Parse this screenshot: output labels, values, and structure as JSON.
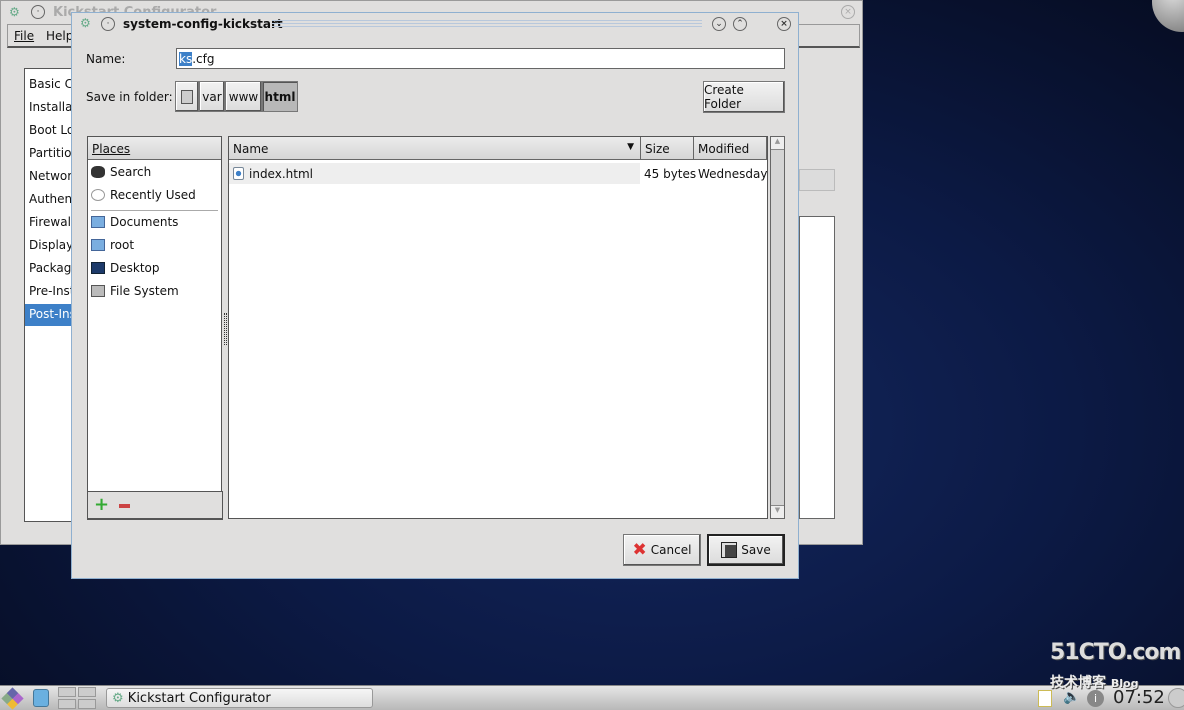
{
  "background_window": {
    "title": "Kickstart Configurator",
    "menu": [
      "File",
      "Help"
    ],
    "sidebar": [
      "Basic C",
      "Installat",
      "Boot Lo",
      "Partition",
      "Network",
      "Authent",
      "Firewall",
      "Display",
      "Package",
      "Pre-Inst",
      "Post-Ins"
    ],
    "selected_index": 10
  },
  "dialog": {
    "title": "system-config-kickstart",
    "name_label": "Name:",
    "name_value_selected": "ks",
    "name_value_rest": ".cfg",
    "folder_label": "Save in folder:",
    "path": [
      "var",
      "www",
      "html"
    ],
    "current_path": "html",
    "create_folder": "Create Folder",
    "places_header": "Places",
    "places": [
      {
        "label": "Search",
        "icon": "binoculars-icon"
      },
      {
        "label": "Recently Used",
        "icon": "clock-icon"
      },
      {
        "label": "Documents",
        "icon": "folder-icon"
      },
      {
        "label": "root",
        "icon": "home-folder-icon"
      },
      {
        "label": "Desktop",
        "icon": "desktop-icon"
      },
      {
        "label": "File System",
        "icon": "drive-icon"
      }
    ],
    "columns": {
      "name": "Name",
      "size": "Size",
      "modified": "Modified"
    },
    "files": [
      {
        "name": "index.html",
        "size": "45 bytes",
        "modified": "Wednesday"
      }
    ],
    "cancel": "Cancel",
    "save": "Save"
  },
  "taskbar": {
    "task": "Kickstart Configurator",
    "clock": "07:52"
  },
  "watermark": {
    "text": "51CTO.com",
    "sub": "技术博客",
    "blog": "Blog"
  },
  "colors": {
    "selection": "#3d80c8",
    "desktop": "#0c1a45"
  }
}
